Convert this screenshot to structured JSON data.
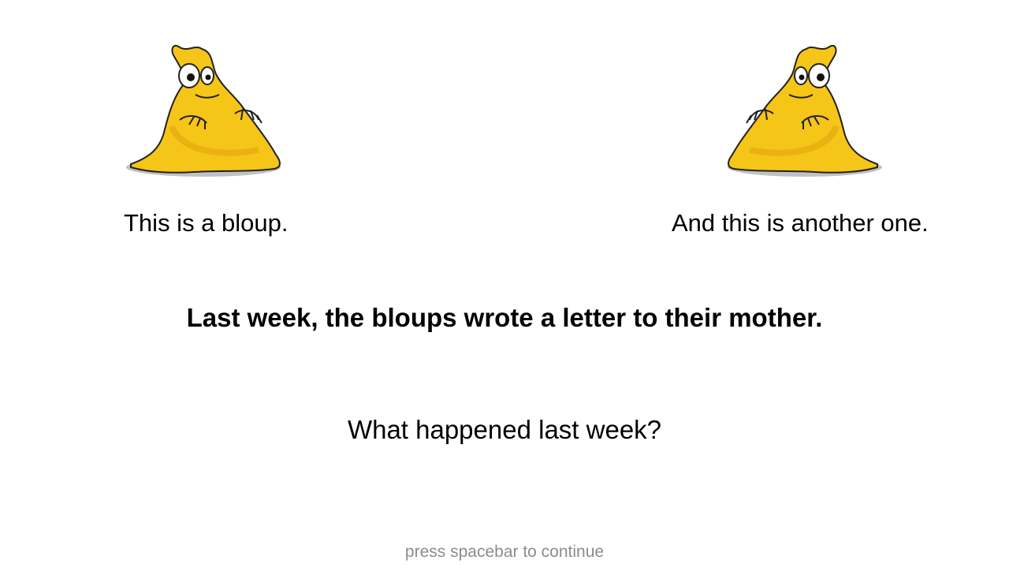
{
  "slide": {
    "creature_left_caption": "This is a bloup.",
    "creature_right_caption": "And this is another one.",
    "statement": "Last week, the bloups wrote a letter to their mother.",
    "question": "What happened  last week?",
    "footer_hint": "press spacebar to continue"
  },
  "creature": {
    "icon": "bloup-creature-illustration",
    "body_color": "#f5c518",
    "shade_color": "#e0a00a",
    "shadow_color": "#9aa0a6"
  }
}
